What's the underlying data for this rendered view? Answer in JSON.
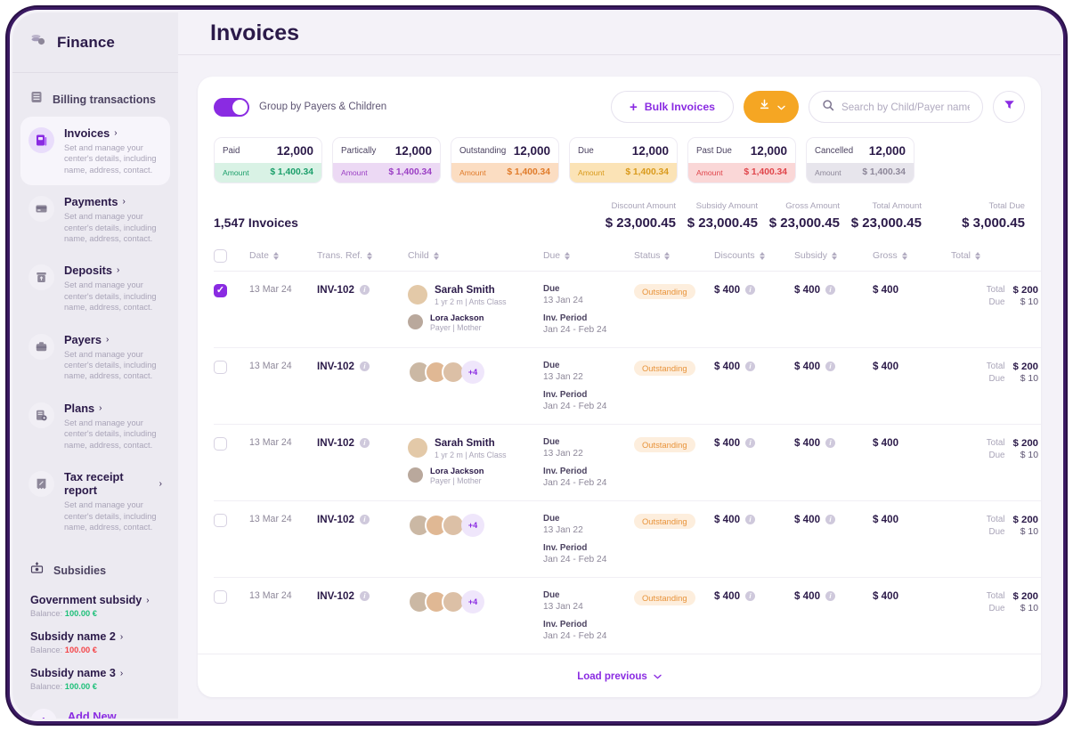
{
  "sidebar": {
    "brand": {
      "title": "Finance",
      "icon": "coins-icon"
    },
    "billing_section": {
      "label": "Billing transactions",
      "icon": "list-icon"
    },
    "items": [
      {
        "label": "Invoices",
        "desc": "Set and manage your center's details, including name, address, contact.",
        "icon": "invoice-icon",
        "active": true
      },
      {
        "label": "Payments",
        "desc": "Set and manage your center's details, including name, address, contact.",
        "icon": "card-icon",
        "active": false
      },
      {
        "label": "Deposits",
        "desc": "Set and manage your center's details, including name, address, contact.",
        "icon": "deposit-icon",
        "active": false
      },
      {
        "label": "Payers",
        "desc": "Set and manage your center's details, including name, address, contact.",
        "icon": "briefcase-icon",
        "active": false
      },
      {
        "label": "Plans",
        "desc": "Set and manage your center's details, including name, address, contact.",
        "icon": "plans-icon",
        "active": false
      },
      {
        "label": "Tax receipt report",
        "desc": "Set and manage your center's details, including name, address, contact.",
        "icon": "receipt-icon",
        "active": false
      }
    ],
    "subsidies_section": {
      "label": "Subsidies",
      "icon": "money-icon"
    },
    "subsidies": [
      {
        "name": "Government subsidy",
        "balance_label": "Balance:",
        "balance": "100.00 €",
        "positive": true
      },
      {
        "name": "Subsidy name 2",
        "balance_label": "Balance:",
        "balance": "100.00 €",
        "positive": false
      },
      {
        "name": "Subsidy name 3",
        "balance_label": "Balance:",
        "balance": "100.00 €",
        "positive": true
      }
    ],
    "add_subsidy": "Add New Subsidy"
  },
  "header": {
    "title": "Invoices"
  },
  "toolbar": {
    "group_toggle_label": "Group by Payers & Children",
    "group_toggle_on": true,
    "bulk_invoices_label": "Bulk Invoices",
    "download_icon": "download-icon",
    "search_placeholder": "Search by Child/Payer name",
    "search_value": "",
    "filter_icon": "filter-icon"
  },
  "stats": [
    {
      "label": "Paid",
      "count": "12,000",
      "amount_label": "Amount",
      "amount": "$ 1,400.34",
      "bg": "#d9f2e5",
      "fg": "#1b9e6a"
    },
    {
      "label": "Partically",
      "count": "12,000",
      "amount_label": "Amount",
      "amount": "$ 1,400.34",
      "bg": "#ecd9f4",
      "fg": "#9b3fc4"
    },
    {
      "label": "Outstanding",
      "count": "12,000",
      "amount_label": "Amount",
      "amount": "$ 1,400.34",
      "bg": "#fbddc2",
      "fg": "#e07b2a"
    },
    {
      "label": "Due",
      "count": "12,000",
      "amount_label": "Amount",
      "amount": "$ 1,400.34",
      "bg": "#fbe3b6",
      "fg": "#d99a1c"
    },
    {
      "label": "Past Due",
      "count": "12,000",
      "amount_label": "Amount",
      "amount": "$ 1,400.34",
      "bg": "#fad7d7",
      "fg": "#e0444a"
    },
    {
      "label": "Cancelled",
      "count": "12,000",
      "amount_label": "Amount",
      "amount": "$ 1,400.34",
      "bg": "#e7e5ec",
      "fg": "#8d8799"
    }
  ],
  "summary": {
    "invoice_count": "1,547 Invoices",
    "cells": [
      {
        "label": "Discount Amount",
        "value": "$ 23,000.45"
      },
      {
        "label": "Subsidy Amount",
        "value": "$ 23,000.45"
      },
      {
        "label": "Gross Amount",
        "value": "$ 23,000.45"
      },
      {
        "label": "Total Amount",
        "value": "$ 23,000.45"
      },
      {
        "label": "Total Due",
        "value": "$ 3,000.45"
      }
    ]
  },
  "table": {
    "columns": [
      {
        "label": "Date",
        "sortable": true
      },
      {
        "label": "Trans. Ref.",
        "sortable": true
      },
      {
        "label": "Child",
        "sortable": true
      },
      {
        "label": "Due",
        "sortable": true
      },
      {
        "label": "Status",
        "sortable": true
      },
      {
        "label": "Discounts",
        "sortable": true
      },
      {
        "label": "Subsidy",
        "sortable": true
      },
      {
        "label": "Gross",
        "sortable": true
      },
      {
        "label": "Total",
        "sortable": true
      }
    ],
    "due_key": "Due",
    "period_key": "Inv. Period",
    "total_key": "Total",
    "duerow_key": "Due",
    "rows": [
      {
        "selected": true,
        "date": "13 Mar 24",
        "ref": "INV-102",
        "child_mode": "detail",
        "child_name": "Sarah Smith",
        "child_meta": "1 yr  2 m | Ants Class",
        "payer_name": "Lora Jackson",
        "payer_meta": "Payer | Mother",
        "due_date": "13 Jan 24",
        "period": "Jan 24 - Feb 24",
        "status": "Outstanding",
        "discounts": "$ 400",
        "subsidy": "$ 400",
        "gross": "$ 400",
        "total": "$ 200",
        "due_amount": "$ 10"
      },
      {
        "selected": false,
        "date": "13 Mar 24",
        "ref": "INV-102",
        "child_mode": "group",
        "extra_count": "+4",
        "due_date": "13 Jan 22",
        "period": "Jan 24 - Feb 24",
        "status": "Outstanding",
        "discounts": "$ 400",
        "subsidy": "$ 400",
        "gross": "$ 400",
        "total": "$ 200",
        "due_amount": "$ 10"
      },
      {
        "selected": false,
        "date": "13 Mar 24",
        "ref": "INV-102",
        "child_mode": "detail",
        "child_name": "Sarah Smith",
        "child_meta": "1 yr  2 m | Ants Class",
        "payer_name": "Lora Jackson",
        "payer_meta": "Payer | Mother",
        "due_date": "13 Jan 22",
        "period": "Jan 24 - Feb 24",
        "status": "Outstanding",
        "discounts": "$ 400",
        "subsidy": "$ 400",
        "gross": "$ 400",
        "total": "$ 200",
        "due_amount": "$ 10"
      },
      {
        "selected": false,
        "date": "13 Mar 24",
        "ref": "INV-102",
        "child_mode": "group",
        "extra_count": "+4",
        "due_date": "13 Jan 22",
        "period": "Jan 24 - Feb 24",
        "status": "Outstanding",
        "discounts": "$ 400",
        "subsidy": "$ 400",
        "gross": "$ 400",
        "total": "$ 200",
        "due_amount": "$ 10"
      },
      {
        "selected": false,
        "date": "13 Mar 24",
        "ref": "INV-102",
        "child_mode": "group",
        "extra_count": "+4",
        "due_date": "13 Jan 24",
        "period": "Jan 24 - Feb 24",
        "status": "Outstanding",
        "discounts": "$ 400",
        "subsidy": "$ 400",
        "gross": "$ 400",
        "total": "$ 200",
        "due_amount": "$ 10"
      }
    ],
    "load_previous": "Load previous"
  },
  "colors": {
    "accent": "#8a2be2",
    "dark": "#2b1a49",
    "orange": "#f5a623",
    "frame": "#3b1a63"
  }
}
